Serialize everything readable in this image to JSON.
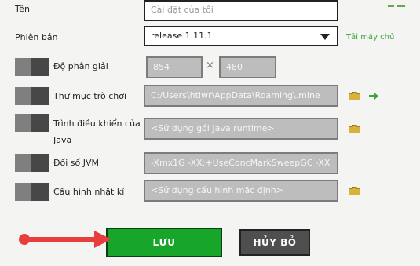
{
  "form": {
    "name": {
      "label": "Tên",
      "placeholder": "Cài đặt của tôi"
    },
    "version": {
      "label": "Phiên bản",
      "value": "release 1.11.1",
      "download_link": "Tải máy chủ"
    },
    "resolution": {
      "label": "Độ phân giải",
      "width": "854",
      "separator": "×",
      "height": "480"
    },
    "game_dir": {
      "label": "Thư mục trò chơi",
      "value": "C:/Users\\htlwr\\AppData\\Roaming\\.mine"
    },
    "java_exec": {
      "label": "Trình điều khiển của Java",
      "placeholder": "<Sử dụng gói Java runtime>"
    },
    "jvm_args": {
      "label": "Đối số JVM",
      "value": "-Xmx1G -XX:+UseConcMarkSweepGC -XX"
    },
    "log_config": {
      "label": "Cấu hình nhật kí",
      "placeholder": "<Sử dụng cấu hình mặc định>"
    }
  },
  "buttons": {
    "save": "LƯU",
    "cancel": "HỦY BỎ"
  },
  "colors": {
    "save": "#17a52a",
    "cancel": "#4f4f4f",
    "link": "#3fa33a",
    "annotation_arrow": "#e73d3d",
    "folder": "#d9b23a"
  },
  "icons": [
    "dropdown-caret-icon",
    "folder-icon",
    "arrow-right-icon"
  ]
}
